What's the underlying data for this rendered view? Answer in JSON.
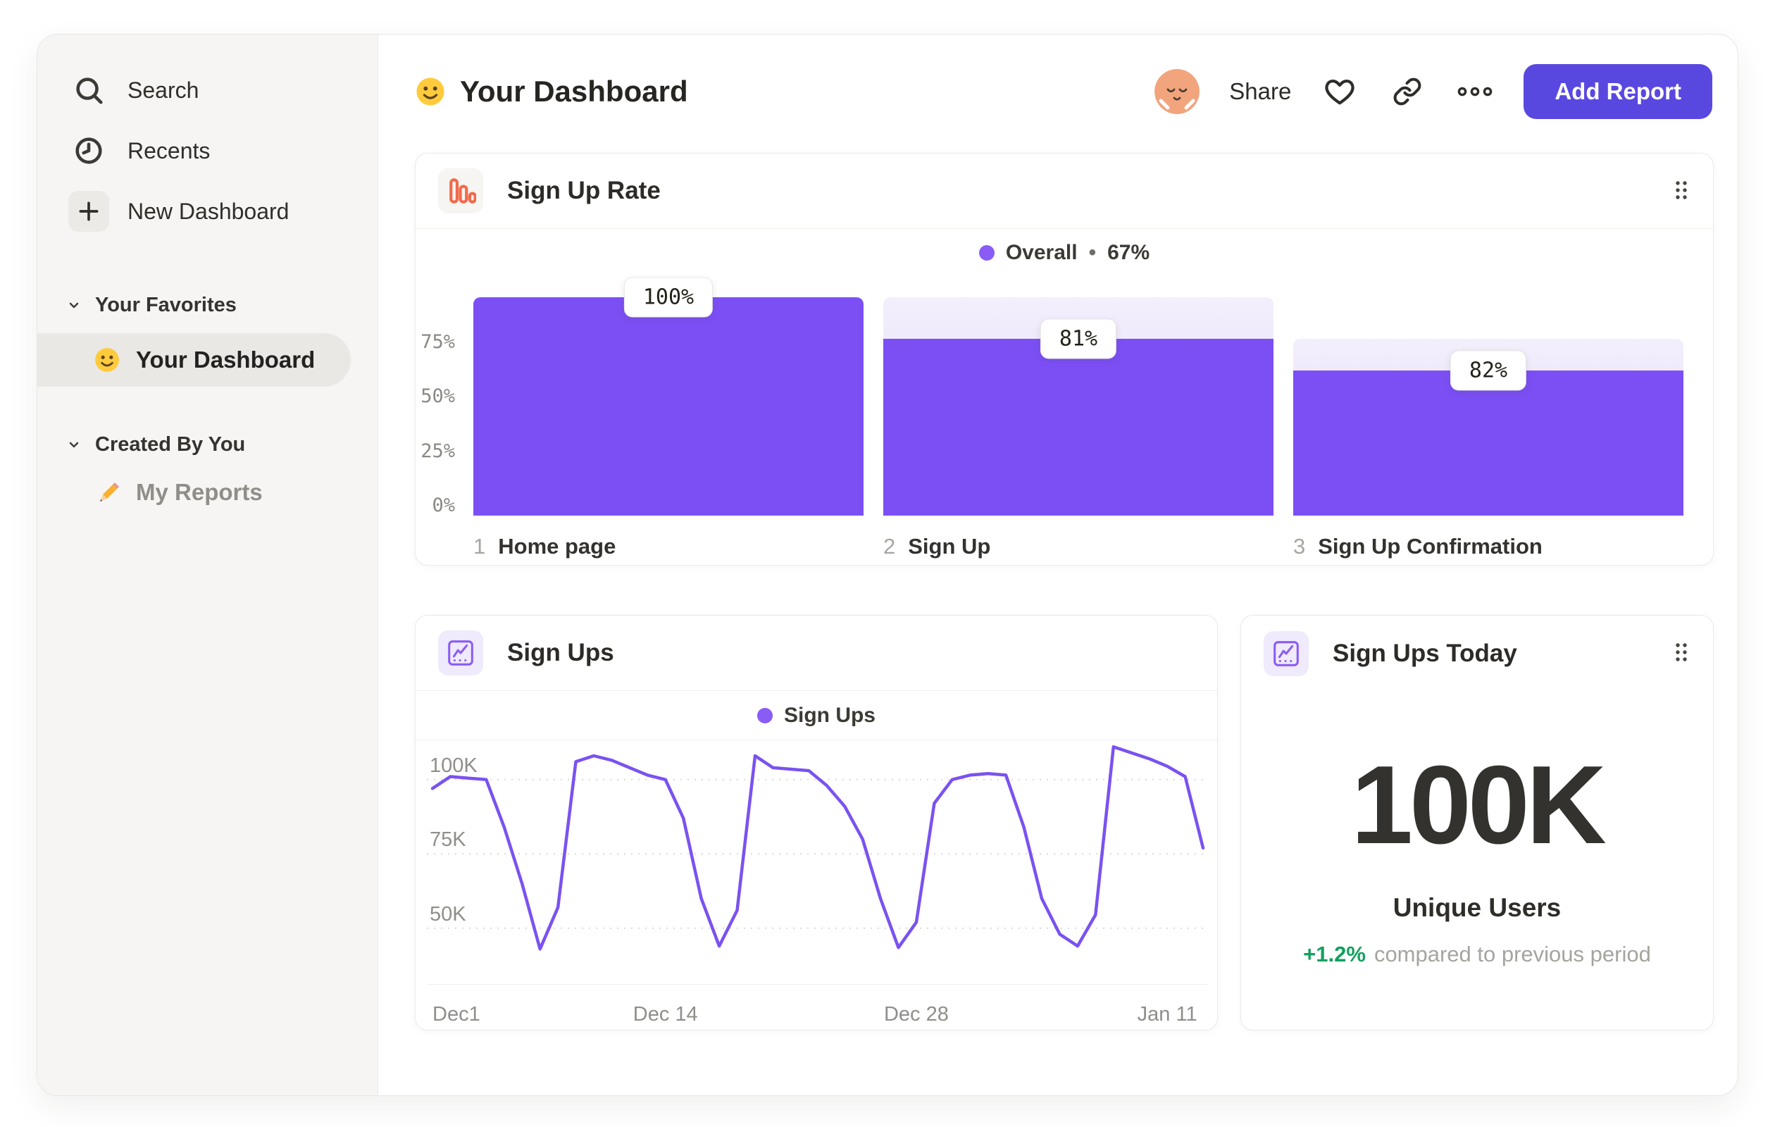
{
  "colors": {
    "accent_button": "#5948e0",
    "bar_purple": "#7c4ff5",
    "line_purple": "#7a52f0",
    "legend_dot": "#8a5cf6",
    "orange_icon": "#f26a4b",
    "green_delta": "#13a05e",
    "sidebar_bg": "#f6f5f3",
    "active_pill": "#e9e8e4"
  },
  "sidebar": {
    "nav": [
      {
        "label": "Search",
        "icon": "search-icon"
      },
      {
        "label": "Recents",
        "icon": "clock-icon"
      },
      {
        "label": "New Dashboard",
        "icon": "plus-icon"
      }
    ],
    "sections": [
      {
        "title": "Your Favorites",
        "items": [
          {
            "label": "Your Dashboard",
            "icon": "smiley-emoji",
            "active": true
          }
        ]
      },
      {
        "title": "Created By You",
        "items": [
          {
            "label": "My Reports",
            "icon": "pencil-emoji",
            "active": false
          }
        ]
      }
    ]
  },
  "header": {
    "title": "Your Dashboard",
    "title_icon": "smiley-emoji",
    "share_label": "Share",
    "add_report_label": "Add Report"
  },
  "metric_card": {
    "title": "Sign Ups Today",
    "value": "100K",
    "label": "Unique Users",
    "delta": "+1.2%",
    "delta_text": "compared to previous period"
  },
  "chart_data": [
    {
      "id": "sign-up-rate-funnel",
      "type": "bar",
      "title": "Sign Up Rate",
      "legend_label": "Overall",
      "legend_separator": "•",
      "legend_value": "67%",
      "categories": [
        "Home page",
        "Sign Up",
        "Sign Up Confirmation"
      ],
      "step_numbers": [
        "1",
        "2",
        "3"
      ],
      "step_conversion_pct": [
        100,
        81,
        82
      ],
      "cumulative_pct": [
        100,
        81,
        66.4
      ],
      "bar_labels": [
        "100%",
        "81%",
        "82%"
      ],
      "ytick_labels": [
        "75%",
        "50%",
        "25%",
        "0%"
      ],
      "ytick_values": [
        75,
        50,
        25,
        0
      ],
      "ylim": [
        0,
        100
      ],
      "bar_color": "#7c4ff5",
      "legend_position": "top-center",
      "grid": "off"
    },
    {
      "id": "sign-ups-line",
      "type": "line",
      "title": "Sign Ups",
      "legend_label": "Sign Ups",
      "line_color": "#7a52f0",
      "x_tick_labels": [
        "Dec1",
        "Dec 14",
        "Dec 28",
        "Jan 11"
      ],
      "x_tick_days": [
        0,
        13,
        27,
        41
      ],
      "x_domain_days": [
        0,
        43
      ],
      "y_tick_labels": [
        "100K",
        "75K",
        "50K"
      ],
      "y_tick_values": [
        100,
        75,
        50
      ],
      "y_unit": "K users",
      "ylim": [
        31,
        112.5
      ],
      "values_k": [
        97,
        101,
        100.5,
        100,
        84,
        65,
        43,
        57,
        106,
        108,
        106.5,
        104,
        101.5,
        100,
        87,
        60,
        44,
        56,
        108,
        104,
        103.5,
        103,
        98,
        91,
        80,
        60,
        43.5,
        52,
        92,
        100,
        101.5,
        102,
        101.5,
        84,
        60,
        48,
        44,
        54.5,
        111,
        109,
        107,
        104.5,
        101,
        77
      ],
      "grid": "dashed-horizontal",
      "legend_position": "top-center"
    }
  ]
}
